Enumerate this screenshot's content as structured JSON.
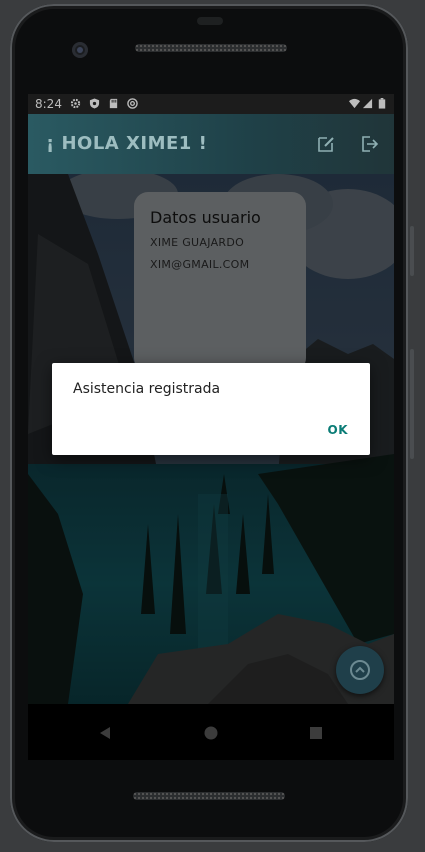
{
  "status_bar": {
    "time": "8:24"
  },
  "app_bar": {
    "title": "¡ HOLA XIME1 !"
  },
  "card": {
    "title": "Datos usuario",
    "name": "XIME GUAJARDO",
    "email": "XIM@GMAIL.COM"
  },
  "dialog": {
    "message": "Asistencia registrada",
    "ok_label": "OK"
  },
  "colors": {
    "accent": "#0a7c76",
    "appbar_start": "#2a5a62",
    "appbar_end": "#203539",
    "fab": "#1f3f4a"
  },
  "icons": {
    "appbar": [
      "edit-icon",
      "logout-icon"
    ],
    "status": [
      "settings-icon",
      "shield-icon",
      "sd-card-icon",
      "at-sign-icon",
      "wifi-icon",
      "cell-signal-icon",
      "battery-icon"
    ],
    "nav": [
      "back-icon",
      "home-icon",
      "recents-icon"
    ],
    "fab": "chevron-up-icon"
  }
}
